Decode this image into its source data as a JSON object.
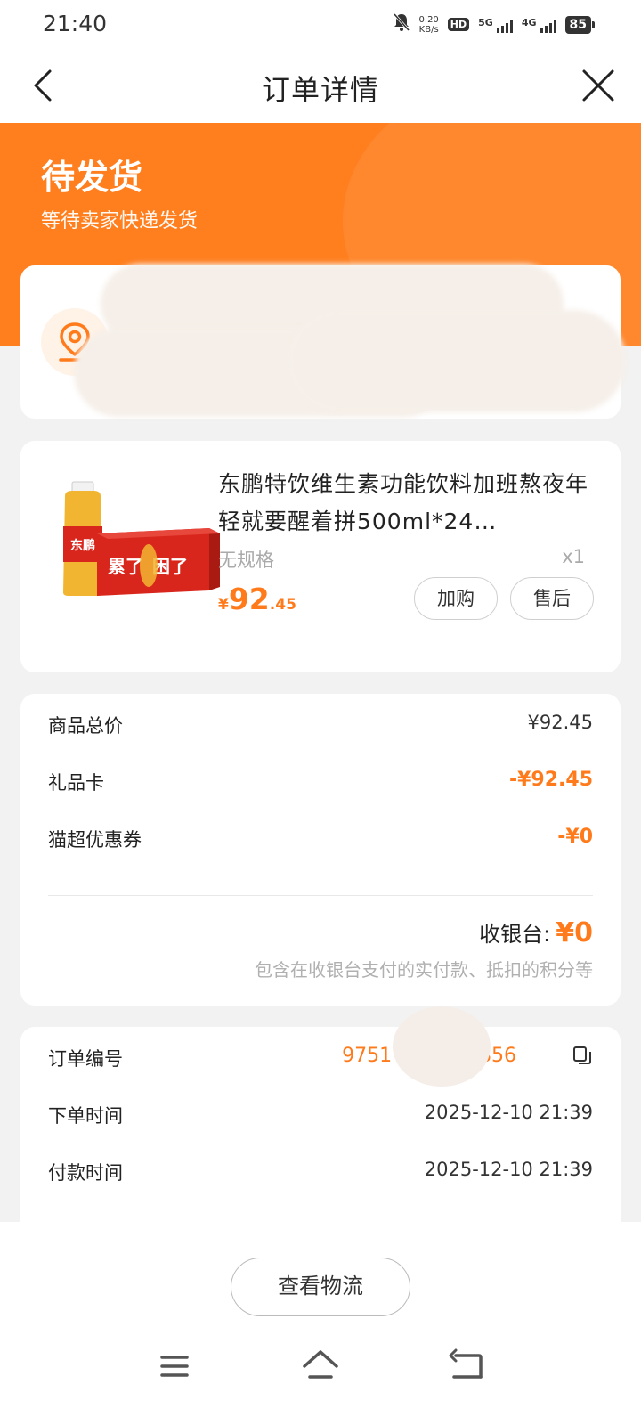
{
  "status_bar": {
    "time": "21:40",
    "net_speed_value": "0.20",
    "net_speed_unit": "KB/s",
    "hd": "HD",
    "signal_1": "5G",
    "signal_2": "4G",
    "battery": "85"
  },
  "nav": {
    "title": "订单详情",
    "back_icon": "chevron-left-icon",
    "close_icon": "close-icon"
  },
  "order_status": {
    "title": "待发货",
    "subtitle": "等待卖家快递发货"
  },
  "address": {
    "icon": "location-pin-icon"
  },
  "product": {
    "name": "东鹏特饮维生素功能饮料加班熬夜年轻就要醒着拼500ml*24…",
    "spec": "无规格",
    "quantity": "x1",
    "price_symbol": "¥",
    "price_integer": "92",
    "price_decimal": ".45",
    "add_button": "加购",
    "after_sale_button": "售后"
  },
  "price_summary": {
    "rows": [
      {
        "label": "商品总价",
        "value": "¥92.45"
      },
      {
        "label": "礼品卡",
        "value": "-¥92.45"
      },
      {
        "label": "猫超优惠券",
        "value": "-¥0"
      }
    ],
    "cashier_label": "收银台:",
    "cashier_amount": "¥0",
    "cashier_note": "包含在收银台支付的实付款、抵扣的积分等"
  },
  "order_info": {
    "rows": [
      {
        "label": "订单编号",
        "value": "9751          21856"
      },
      {
        "label": "下单时间",
        "value": "2025-12-10 21:39"
      },
      {
        "label": "付款时间",
        "value": "2025-12-10 21:39"
      }
    ]
  },
  "bottom": {
    "logistics_button": "查看物流"
  },
  "colors": {
    "accent": "#ff7f1f",
    "price": "#ff7a1a"
  }
}
